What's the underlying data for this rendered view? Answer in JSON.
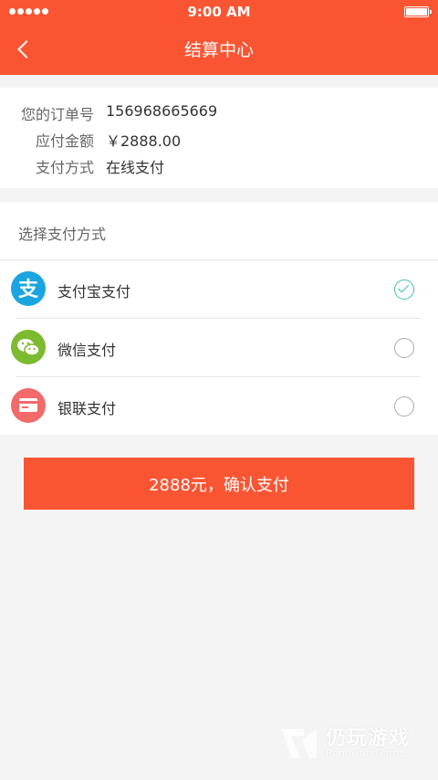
{
  "status_bar": {
    "time": "9:00 AM",
    "signal_icon": "signal-dots-icon",
    "battery_icon": "battery-icon"
  },
  "nav": {
    "title": "结算中心",
    "back_icon": "chevron-left-icon"
  },
  "order": {
    "number_label": "您的订单号",
    "number_value": "156968665669",
    "amount_label": "应付金额",
    "amount_value": "￥2888.00",
    "method_label": "支付方式",
    "method_value": "在线支付"
  },
  "payment": {
    "header": "选择支付方式",
    "options": [
      {
        "label": "支付宝支付",
        "icon": "alipay-icon",
        "selected": true
      },
      {
        "label": "微信支付",
        "icon": "wechat-icon",
        "selected": false
      },
      {
        "label": "银联支付",
        "icon": "unionpay-card-icon",
        "selected": false
      }
    ]
  },
  "confirm_button": {
    "label": "2888元，确认支付"
  },
  "watermark": {
    "title": "仍玩游戏",
    "subtitle": "Rengwan Games"
  },
  "colors": {
    "brand": "#fa5533",
    "check": "#3cc2b4",
    "alipay": "#1aa5e0",
    "wechat": "#7cba2f",
    "unionpay": "#f26a6a"
  }
}
